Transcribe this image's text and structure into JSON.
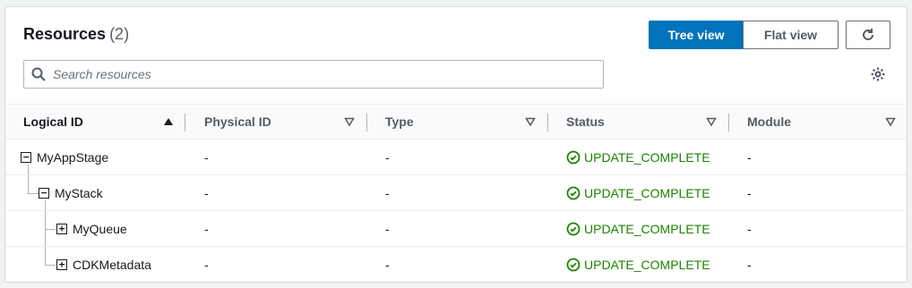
{
  "header": {
    "title": "Resources",
    "count": "(2)"
  },
  "view_toggle": {
    "tree_label": "Tree view",
    "flat_label": "Flat view",
    "selected": "Tree view"
  },
  "search": {
    "placeholder": "Search resources",
    "value": ""
  },
  "table": {
    "columns": [
      "Logical ID",
      "Physical ID",
      "Type",
      "Status",
      "Module"
    ],
    "sorted_column": "Logical ID",
    "rows": [
      {
        "logical_id": "MyAppStage",
        "physical_id": "-",
        "type": "-",
        "status": "UPDATE_COMPLETE",
        "module": "-",
        "toggle": "−"
      },
      {
        "logical_id": "MyStack",
        "physical_id": "-",
        "type": "-",
        "status": "UPDATE_COMPLETE",
        "module": "-",
        "toggle": "−"
      },
      {
        "logical_id": "MyQueue",
        "physical_id": "-",
        "type": "-",
        "status": "UPDATE_COMPLETE",
        "module": "-",
        "toggle": "+"
      },
      {
        "logical_id": "CDKMetadata",
        "physical_id": "-",
        "type": "-",
        "status": "UPDATE_COMPLETE",
        "module": "-",
        "toggle": "+"
      }
    ]
  },
  "colors": {
    "primary": "#0073bb",
    "success": "#1d8102",
    "border": "#d5dbdb",
    "text": "#16191f",
    "muted": "#545b64"
  },
  "icons": {
    "search": "search-icon",
    "refresh": "refresh-icon",
    "settings": "gear-icon",
    "status": "check-circle-icon",
    "sort_active": "caret-up-filled-icon",
    "sort_inactive": "caret-down-outline-icon"
  }
}
